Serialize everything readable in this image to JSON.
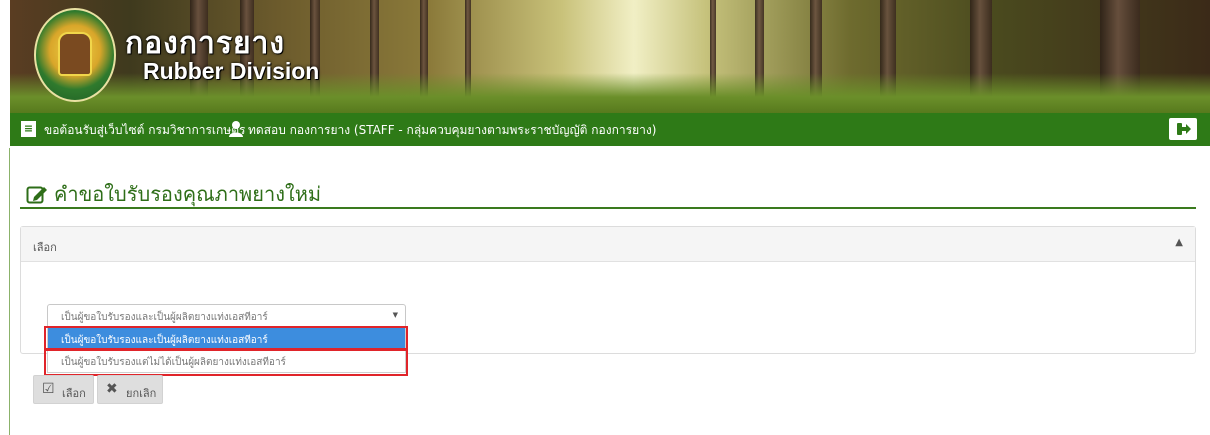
{
  "header": {
    "brand_th": "กองการยาง",
    "brand_en": "Rubber Division"
  },
  "navbar": {
    "welcome": "ขอต้อนรับสู่เว็บไซต์ กรมวิชาการเกษตร",
    "user": "ทดสอบ กองการยาง (STAFF - กลุ่มควบคุมยางตามพระราชบัญญัติ กองการยาง)"
  },
  "page": {
    "title": "คำขอใบรับรองคุณภาพยางใหม่"
  },
  "panel": {
    "title": "เลือก"
  },
  "select": {
    "value": "เป็นผู้ขอใบรับรองและเป็นผู้ผลิตยางแท่งเอสทีอาร์",
    "options": [
      "เป็นผู้ขอใบรับรองและเป็นผู้ผลิตยางแท่งเอสทีอาร์",
      "เป็นผู้ขอใบรับรองแต่ไม่ได้เป็นผู้ผลิตยางแท่งเอสทีอาร์"
    ]
  },
  "buttons": {
    "choose": "เลือก",
    "cancel": "ยกเลิก"
  },
  "colors": {
    "nav_green": "#2e7a17",
    "title_green": "#2e6e18",
    "selected_option": "#3d8dde",
    "highlight_red": "#e0242a"
  },
  "icons": [
    "menu-icon",
    "user-icon",
    "logout-icon",
    "edit-icon",
    "chevron-up-icon",
    "caret-down-icon",
    "check-icon",
    "close-icon"
  ]
}
